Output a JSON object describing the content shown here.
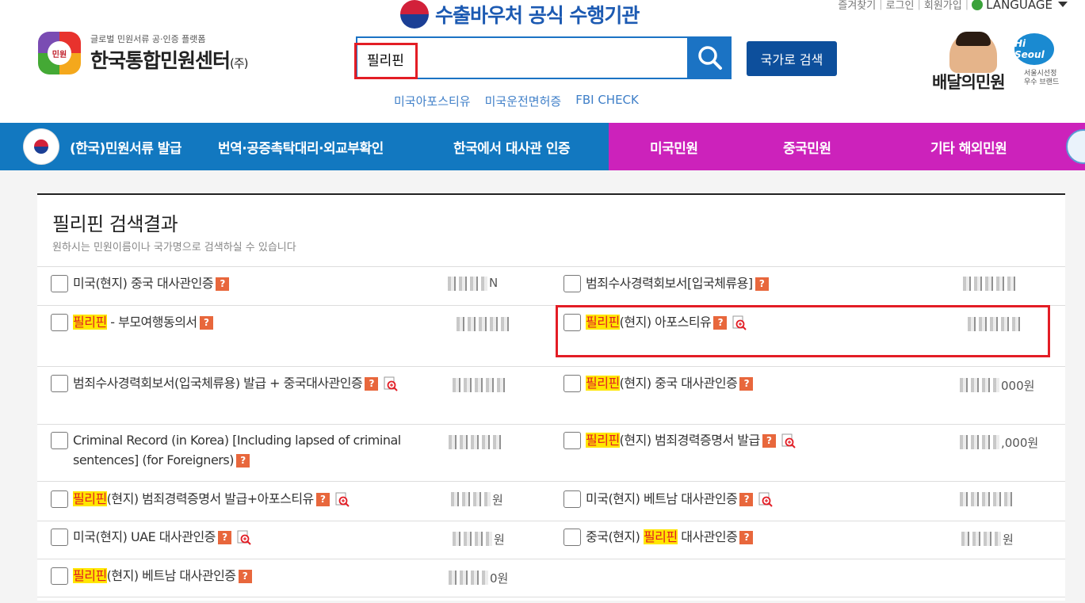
{
  "header": {
    "top_links": [
      "즐겨찾기",
      "로그인",
      "회원가입"
    ],
    "language_label": "LANGUAGE",
    "banner_text": "수출바우처 공식 수행기관",
    "logo_badge": "민원",
    "logo_subtitle": "글로벌 민원서류 공·인증 플랫폼",
    "logo_title": "한국통합민원센터",
    "logo_suffix": "(주)",
    "search_value": "필리핀",
    "country_search_label": "국가로 검색",
    "quick_links": [
      "미국아포스티유",
      "미국운전면허증",
      "FBI CHECK"
    ],
    "partner_title": "배달의민원",
    "partner_badge": "Hi Seoul",
    "partner_sub1": "서울시선정",
    "partner_sub2": "우수 브랜드"
  },
  "nav": {
    "items": [
      {
        "label": "(한국)민원서류 발급"
      },
      {
        "label": "번역·공증촉탁대리·외교부확인"
      },
      {
        "label": "한국에서 대사관 인증"
      },
      {
        "label": "미국민원"
      },
      {
        "label": "중국민원"
      },
      {
        "label": "기타 해외민원"
      }
    ]
  },
  "results": {
    "title": "필리핀 검색결과",
    "description": "원하시는 민원이름이나 국가명으로 검색하실 수 있습니다",
    "highlight": "필리핀",
    "items": [
      {
        "pre": "",
        "hl": "",
        "post": "미국(현지) 중국 대사관인증",
        "price": "N",
        "mag": false
      },
      {
        "pre": "",
        "hl": "",
        "post": "범죄수사경력회보서[입국체류용]",
        "price": "",
        "mag": false
      },
      {
        "pre": "",
        "hl": "필리핀",
        "post": " - 부모여행동의서",
        "price": "",
        "mag": false
      },
      {
        "pre": "",
        "hl": "필리핀",
        "post": "(현지) 아포스티유",
        "price": "",
        "mag": true
      },
      {
        "pre": "",
        "hl": "",
        "post": "범죄수사경력회보서(입국체류용) 발급 + 중국대사관인증",
        "price": "",
        "mag": true
      },
      {
        "pre": "",
        "hl": "필리핀",
        "post": "(현지) 중국 대사관인증",
        "price": "000원",
        "mag": false
      },
      {
        "pre": "",
        "hl": "",
        "post": "Criminal Record (in Korea) [Including lapsed of criminal sentences] (for Foreigners)",
        "price": "",
        "mag": false
      },
      {
        "pre": "",
        "hl": "필리핀",
        "post": "(현지) 범죄경력증명서 발급",
        "price": ",000원",
        "mag": true
      },
      {
        "pre": "",
        "hl": "필리핀",
        "post": "(현지) 범죄경력증명서 발급+아포스티유",
        "price": "원",
        "mag": true
      },
      {
        "pre": "",
        "hl": "",
        "post": "미국(현지) 베트남 대사관인증",
        "price": "",
        "mag": true
      },
      {
        "pre": "",
        "hl": "",
        "post": "미국(현지) UAE 대사관인증",
        "price": "원",
        "mag": true
      },
      {
        "pre": "중국(현지) ",
        "hl": "필리핀",
        "post": " 대사관인증",
        "price": "원",
        "mag": false
      },
      {
        "pre": "",
        "hl": "필리핀",
        "post": "(현지) 베트남 대사관인증",
        "price": "0원",
        "mag": false
      }
    ]
  },
  "colors": {
    "nav_blue": "#1278c0",
    "nav_pink": "#cc22bb",
    "search_blue": "#1b73c4",
    "country_btn": "#0d4f9c",
    "highlight_bg": "#ffe600",
    "highlight_text": "#e01c24",
    "annotation_red": "#e31d25"
  },
  "icons": {
    "search": "magnifier-icon",
    "help": "question-icon",
    "preview": "zoom-doc-icon"
  },
  "help_glyph": "?"
}
